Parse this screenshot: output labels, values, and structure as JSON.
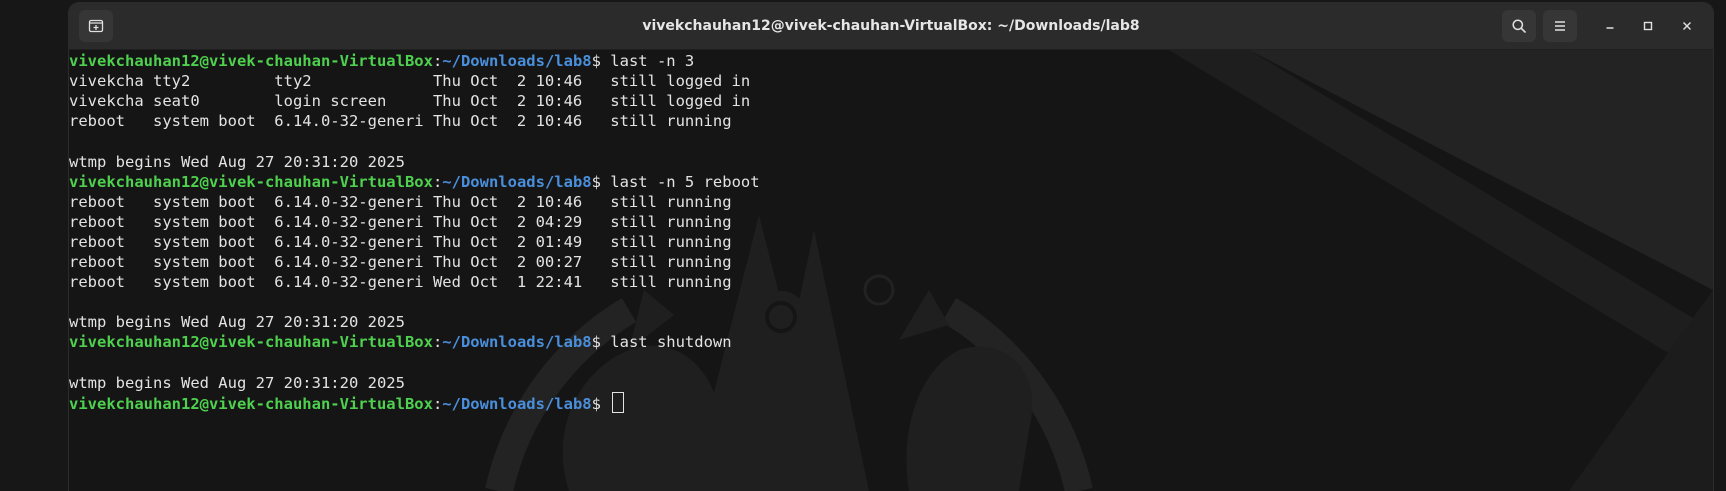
{
  "window": {
    "title": "vivekchauhan12@vivek-chauhan-VirtualBox: ~/Downloads/lab8",
    "new_tab_icon": "new-tab-icon",
    "search_icon": "search-icon",
    "menu_icon": "hamburger-menu-icon",
    "minimize_icon": "minimize-icon",
    "maximize_icon": "maximize-icon",
    "close_icon": "close-icon"
  },
  "colors": {
    "prompt_user": "#4ed14e",
    "prompt_path": "#4a8fdc",
    "text": "#e3e3e3",
    "background": "#151515",
    "headerbar": "#2b2b2b"
  },
  "prompt": {
    "user_host": "vivekchauhan12@vivek-chauhan-VirtualBox",
    "sep": ":",
    "path": "~/Downloads/lab8",
    "dollar": "$ "
  },
  "terminal_lines": [
    {
      "type": "prompt",
      "cmd": "last -n 3"
    },
    {
      "type": "output",
      "text": "vivekcha tty2         tty2             Thu Oct  2 10:46   still logged in"
    },
    {
      "type": "output",
      "text": "vivekcha seat0        login screen     Thu Oct  2 10:46   still logged in"
    },
    {
      "type": "output",
      "text": "reboot   system boot  6.14.0-32-generi Thu Oct  2 10:46   still running"
    },
    {
      "type": "output",
      "text": ""
    },
    {
      "type": "output",
      "text": "wtmp begins Wed Aug 27 20:31:20 2025"
    },
    {
      "type": "prompt",
      "cmd": "last -n 5 reboot"
    },
    {
      "type": "output",
      "text": "reboot   system boot  6.14.0-32-generi Thu Oct  2 10:46   still running"
    },
    {
      "type": "output",
      "text": "reboot   system boot  6.14.0-32-generi Thu Oct  2 04:29   still running"
    },
    {
      "type": "output",
      "text": "reboot   system boot  6.14.0-32-generi Thu Oct  2 01:49   still running"
    },
    {
      "type": "output",
      "text": "reboot   system boot  6.14.0-32-generi Thu Oct  2 00:27   still running"
    },
    {
      "type": "output",
      "text": "reboot   system boot  6.14.0-32-generi Wed Oct  1 22:41   still running"
    },
    {
      "type": "output",
      "text": ""
    },
    {
      "type": "output",
      "text": "wtmp begins Wed Aug 27 20:31:20 2025"
    },
    {
      "type": "prompt",
      "cmd": "last shutdown"
    },
    {
      "type": "output",
      "text": ""
    },
    {
      "type": "output",
      "text": "wtmp begins Wed Aug 27 20:31:20 2025"
    },
    {
      "type": "prompt",
      "cmd": "",
      "cursor": true
    }
  ]
}
